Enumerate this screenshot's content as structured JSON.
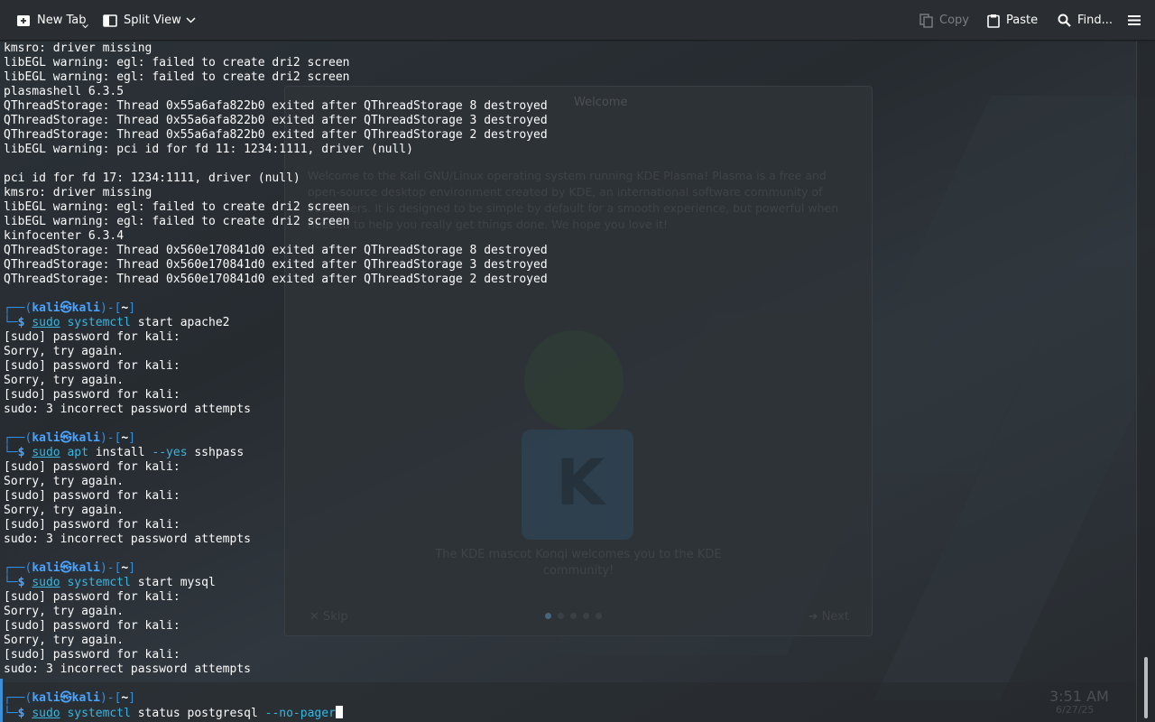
{
  "toolbar": {
    "new_tab": "New Tab",
    "split_view": "Split View",
    "copy": "Copy",
    "paste": "Paste",
    "find": "Find..."
  },
  "background": {
    "welcome_title": "Welcome",
    "welcome_text": "Welcome to the Kali GNU/Linux operating system running KDE Plasma! Plasma is a free and open-source desktop environment created by KDE, an international software community of volunteers. It is designed to be simple by default for a smooth experience, but powerful when needed to help you really get things done. We hope you love it!",
    "caption": "The KDE mascot Konqi welcomes you to the KDE community!",
    "skip": "Skip",
    "next": "Next",
    "clock": "3:51 AM",
    "date": "6/27/25"
  },
  "terminal": {
    "prompt": {
      "user": "kali",
      "at": "㉿",
      "host": "kali",
      "dir": "~"
    },
    "log_lines": [
      "kmsro: driver missing",
      "libEGL warning: egl: failed to create dri2 screen",
      "libEGL warning: egl: failed to create dri2 screen",
      "plasmashell 6.3.5",
      "QThreadStorage: Thread 0x55a6afa822b0 exited after QThreadStorage 8 destroyed",
      "QThreadStorage: Thread 0x55a6afa822b0 exited after QThreadStorage 3 destroyed",
      "QThreadStorage: Thread 0x55a6afa822b0 exited after QThreadStorage 2 destroyed",
      "libEGL warning: pci id for fd 11: 1234:1111, driver (null)",
      "",
      "pci id for fd 17: 1234:1111, driver (null)",
      "kmsro: driver missing",
      "libEGL warning: egl: failed to create dri2 screen",
      "libEGL warning: egl: failed to create dri2 screen",
      "kinfocenter 6.3.4",
      "QThreadStorage: Thread 0x560e170841d0 exited after QThreadStorage 8 destroyed",
      "QThreadStorage: Thread 0x560e170841d0 exited after QThreadStorage 3 destroyed",
      "QThreadStorage: Thread 0x560e170841d0 exited after QThreadStorage 2 destroyed",
      ""
    ],
    "commands": [
      {
        "sudo": "sudo",
        "program": "systemctl",
        "args": " start apache2",
        "opt": "",
        "output": [
          "[sudo] password for kali:",
          "Sorry, try again.",
          "[sudo] password for kali:",
          "Sorry, try again.",
          "[sudo] password for kali:",
          "sudo: 3 incorrect password attempts",
          ""
        ]
      },
      {
        "sudo": "sudo",
        "program": "apt",
        "args": " install ",
        "opt": "--yes",
        "args2": " sshpass",
        "output": [
          "[sudo] password for kali:",
          "Sorry, try again.",
          "[sudo] password for kali:",
          "Sorry, try again.",
          "[sudo] password for kali:",
          "sudo: 3 incorrect password attempts",
          ""
        ]
      },
      {
        "sudo": "sudo",
        "program": "systemctl",
        "args": " start mysql",
        "opt": "",
        "output": [
          "[sudo] password for kali:",
          "Sorry, try again.",
          "[sudo] password for kali:",
          "Sorry, try again.",
          "[sudo] password for kali:",
          "sudo: 3 incorrect password attempts",
          ""
        ]
      },
      {
        "sudo": "sudo",
        "program": "systemctl",
        "args": " status postgresql ",
        "opt": "--no-pager",
        "output": []
      }
    ]
  }
}
